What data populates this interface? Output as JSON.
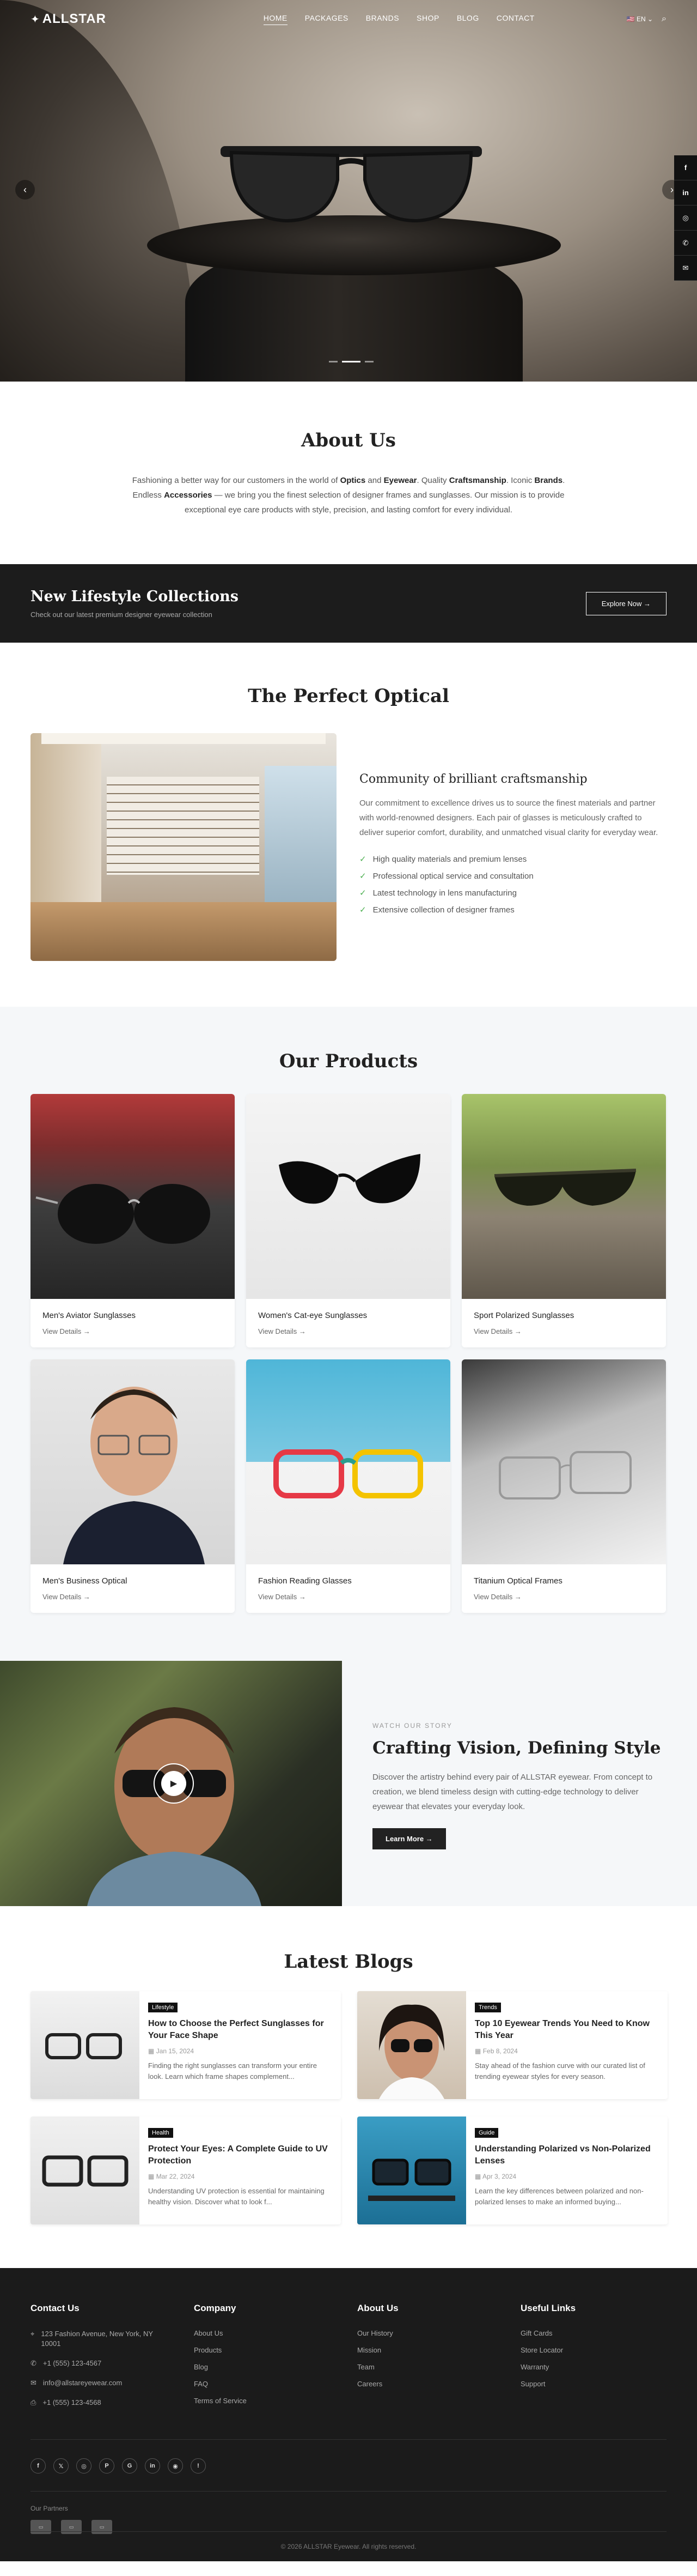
{
  "nav": {
    "logo": "ALLSTAR",
    "items": [
      "HOME",
      "PACKAGES",
      "BRANDS",
      "SHOP",
      "BLOG",
      "CONTACT"
    ],
    "active": "HOME",
    "language": "EN"
  },
  "hero": {
    "slides": 3,
    "active_slide": 2
  },
  "social_float": [
    "f",
    "in",
    "◎",
    "✆",
    "✉"
  ],
  "about": {
    "title": "About Us",
    "parts": [
      "Fashioning a better way for our customers in the world of ",
      "Optics",
      " and ",
      "Eyewear",
      ". Quality ",
      "Craftsmanship",
      ". Iconic ",
      "Brands",
      ". Endless ",
      "Accessories",
      " — we bring you the finest selection of designer frames and sunglasses. Our mission is to provide exceptional eye care products with style, precision, and lasting comfort for every individual."
    ]
  },
  "cta": {
    "title": "New Lifestyle Collections",
    "subtitle": "Check out our latest premium designer eyewear collection",
    "button": "Explore Now →"
  },
  "optical": {
    "title": "The Perfect Optical",
    "heading": "Community of brilliant craftsmanship",
    "text": "Our commitment to excellence drives us to source the finest materials and partner with world-renowned designers. Each pair of glasses is meticulously crafted to deliver superior comfort, durability, and unmatched visual clarity for everyday wear.",
    "features": [
      "High quality materials and premium lenses",
      "Professional optical service and consultation",
      "Latest technology in lens manufacturing",
      "Extensive collection of designer frames"
    ]
  },
  "products": {
    "title": "Our Products",
    "view_label": "View Details →",
    "items": [
      {
        "name": "Men's Aviator Sunglasses"
      },
      {
        "name": "Women's Cat-eye Sunglasses"
      },
      {
        "name": "Sport Polarized Sunglasses"
      },
      {
        "name": "Men's Business Optical"
      },
      {
        "name": "Fashion Reading Glasses"
      },
      {
        "name": "Titanium Optical Frames"
      }
    ]
  },
  "story": {
    "eyebrow": "WATCH OUR STORY",
    "title": "Crafting Vision, Defining Style",
    "text": "Discover the artistry behind every pair of ALLSTAR eyewear. From concept to creation, we blend timeless design with cutting-edge technology to deliver eyewear that elevates your everyday look.",
    "button": "Learn More →"
  },
  "blogs": {
    "title": "Latest Blogs",
    "posts": [
      {
        "tag": "Lifestyle",
        "title": "How to Choose the Perfect Sunglasses for Your Face Shape",
        "date": "Jan 15, 2024",
        "excerpt": "Finding the right sunglasses can transform your entire look. Learn which frame shapes complement..."
      },
      {
        "tag": "Trends",
        "title": "Top 10 Eyewear Trends You Need to Know This Year",
        "date": "Feb 8, 2024",
        "excerpt": "Stay ahead of the fashion curve with our curated list of trending eyewear styles for every season."
      },
      {
        "tag": "Health",
        "title": "Protect Your Eyes: A Complete Guide to UV Protection",
        "date": "Mar 22, 2024",
        "excerpt": "Understanding UV protection is essential for maintaining healthy vision. Discover what to look f..."
      },
      {
        "tag": "Guide",
        "title": "Understanding Polarized vs Non-Polarized Lenses",
        "date": "Apr 3, 2024",
        "excerpt": "Learn the key differences between polarized and non-polarized lenses to make an informed buying..."
      }
    ]
  },
  "footer": {
    "contact": {
      "title": "Contact Us",
      "address": "123 Fashion Avenue, New York, NY 10001",
      "phone": "+1 (555) 123-4567",
      "email": "info@allstareyewear.com",
      "fax": "+1 (555) 123-4568"
    },
    "company": {
      "title": "Company",
      "links": [
        "About Us",
        "Products",
        "Blog",
        "FAQ",
        "Terms of Service"
      ]
    },
    "about": {
      "title": "About Us",
      "links": [
        "Our History",
        "Mission",
        "Team",
        "Careers"
      ]
    },
    "useful": {
      "title": "Useful Links",
      "links": [
        "Gift Cards",
        "Store Locator",
        "Warranty",
        "Support"
      ]
    },
    "socials": [
      "f",
      "𝕏",
      "◎",
      "P",
      "G",
      "in",
      "◉",
      "!"
    ],
    "partners_label": "Our Partners",
    "partners": [
      "▭",
      "▭",
      "▭"
    ],
    "copyright": "© 2026 ALLSTAR Eyewear. All rights reserved."
  }
}
